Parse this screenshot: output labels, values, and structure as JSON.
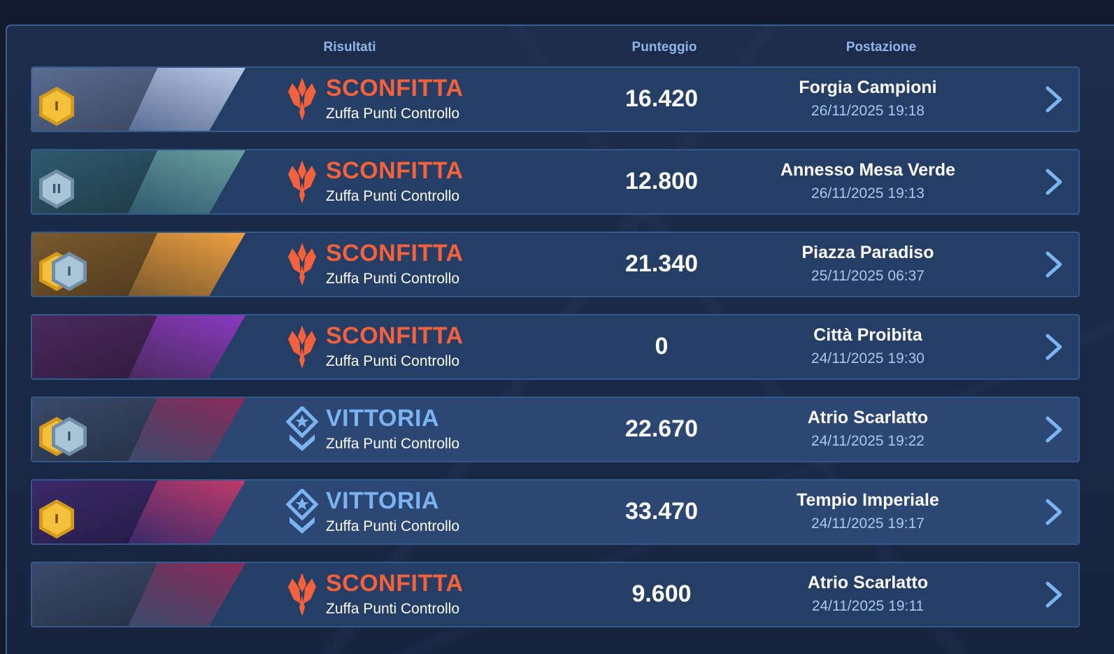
{
  "header": {
    "results": "Risultati",
    "score": "Punteggio",
    "location": "Postazione"
  },
  "colors": {
    "loss": "#f4613a",
    "win": "#7bb4f0",
    "row": "#253e66",
    "accent": "#3b5f96"
  },
  "matches": [
    {
      "result": "SCONFITTA",
      "outcome": "loss",
      "mode": "Zuffa Punti Controllo",
      "score": "16.420",
      "location": "Forgia Campioni",
      "datetime": "26/11/2025 19:18",
      "badges": [
        {
          "type": "gold",
          "label": "I"
        }
      ],
      "theme": [
        "#5a6d93",
        "#b9c8e6"
      ]
    },
    {
      "result": "SCONFITTA",
      "outcome": "loss",
      "mode": "Zuffa Punti Controllo",
      "score": "12.800",
      "location": "Annesso Mesa Verde",
      "datetime": "26/11/2025 19:13",
      "badges": [
        {
          "type": "silver",
          "label": "II"
        }
      ],
      "theme": [
        "#2f5a6e",
        "#6aa0a0"
      ]
    },
    {
      "result": "SCONFITTA",
      "outcome": "loss",
      "mode": "Zuffa Punti Controllo",
      "score": "21.340",
      "location": "Piazza Paradiso",
      "datetime": "25/11/2025 06:37",
      "badges": [
        {
          "type": "gold",
          "label": "I"
        },
        {
          "type": "silver",
          "label": "I"
        }
      ],
      "theme": [
        "#7a5a2e",
        "#f0a040"
      ]
    },
    {
      "result": "SCONFITTA",
      "outcome": "loss",
      "mode": "Zuffa Punti Controllo",
      "score": "0",
      "location": "Città Proibita",
      "datetime": "24/11/2025 19:30",
      "badges": [],
      "theme": [
        "#4a2a5e",
        "#8a3ac0"
      ]
    },
    {
      "result": "VITTORIA",
      "outcome": "win",
      "mode": "Zuffa Punti Controllo",
      "score": "22.670",
      "location": "Atrio Scarlatto",
      "datetime": "24/11/2025 19:22",
      "badges": [
        {
          "type": "gold",
          "label": "I"
        },
        {
          "type": "silver",
          "label": "I"
        }
      ],
      "theme": [
        "#3a4a6a",
        "#8a2a5a"
      ]
    },
    {
      "result": "VITTORIA",
      "outcome": "win",
      "mode": "Zuffa Punti Controllo",
      "score": "33.470",
      "location": "Tempio Imperiale",
      "datetime": "24/11/2025 19:17",
      "badges": [
        {
          "type": "gold",
          "label": "I"
        }
      ],
      "theme": [
        "#3a2a6a",
        "#c03a6a"
      ]
    },
    {
      "result": "SCONFITTA",
      "outcome": "loss",
      "mode": "Zuffa Punti Controllo",
      "score": "9.600",
      "location": "Atrio Scarlatto",
      "datetime": "24/11/2025 19:11",
      "badges": [],
      "theme": [
        "#3a4a6a",
        "#8a2a5a"
      ]
    }
  ]
}
